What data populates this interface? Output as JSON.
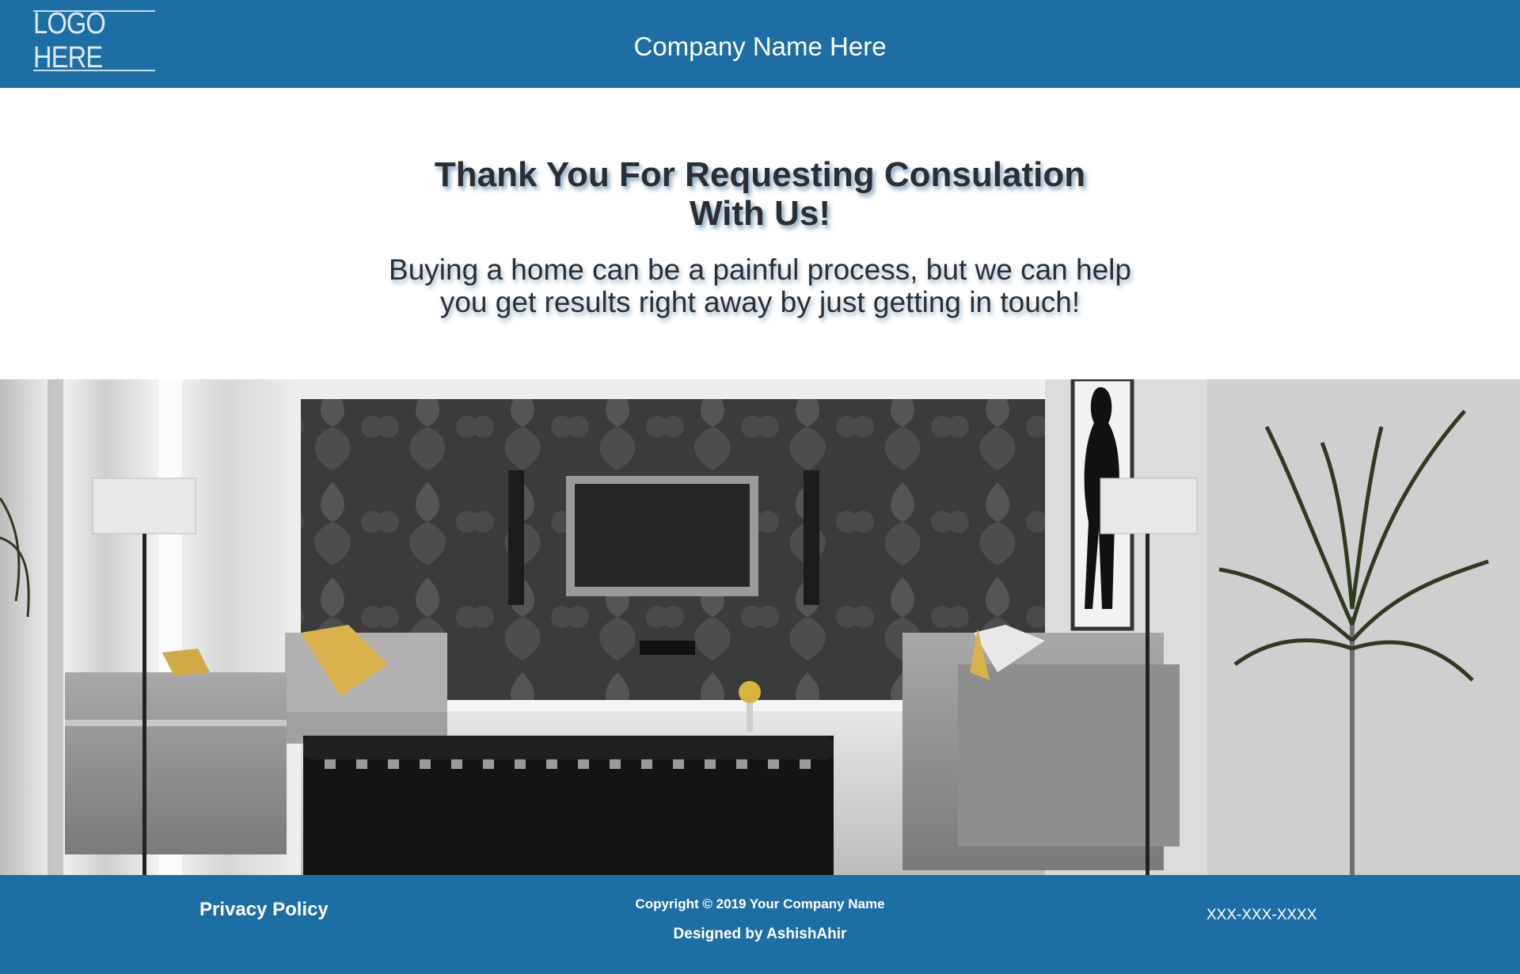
{
  "header": {
    "logo_text": "LOGO HERE",
    "company_name": "Company Name Here"
  },
  "main": {
    "headline": "Thank You For Requesting Consulation With Us!",
    "subtext": "Buying a home can be a painful process, but we can help you get results right away by just getting in touch!"
  },
  "footer": {
    "privacy_label": "Privacy Policy",
    "copyright": "Copyright © 2019 Your Company Name",
    "designed_by": "Designed by AshishAhir",
    "phone": "XXX-XXX-XXXX"
  },
  "colors": {
    "brand_blue": "#1e6ea6",
    "text_dark": "#2b2f33"
  }
}
